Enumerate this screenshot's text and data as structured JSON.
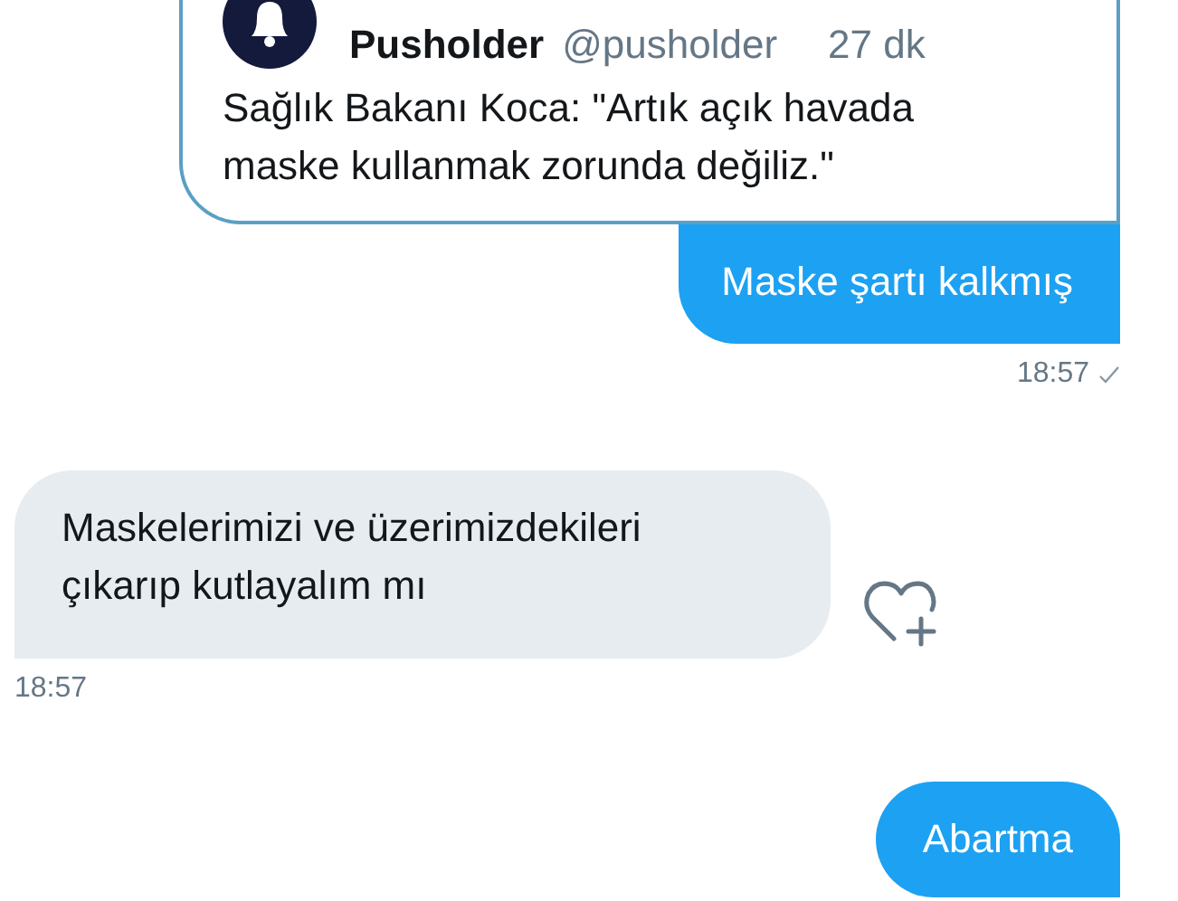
{
  "messages": [
    {
      "kind": "sent",
      "shared_tweet": {
        "name": "Pusholder",
        "handle": "@pusholder",
        "time": "27 dk",
        "text": "Sağlık Bakanı Koca: \"Artık açık havada maske kullanmak zorunda değiliz.\""
      },
      "text": "Maske şartı kalkmış",
      "time": "18:57"
    },
    {
      "kind": "received",
      "text": "Maskelerimizi ve üzerimizdekileri çıkarıp kutlayalım mı",
      "time": "18:57"
    },
    {
      "kind": "sent",
      "text": "Abartma"
    }
  ]
}
